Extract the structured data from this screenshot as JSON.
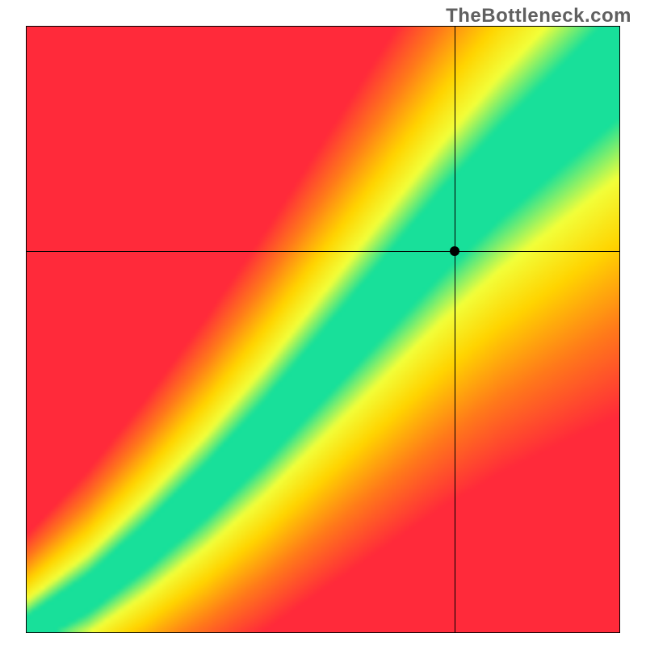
{
  "watermark": "TheBottleneck.com",
  "chart_data": {
    "type": "heatmap",
    "title": "",
    "xlabel": "",
    "ylabel": "",
    "xlim": [
      0,
      100
    ],
    "ylim": [
      0,
      100
    ],
    "crosshair": {
      "x": 72,
      "y": 63
    },
    "point": {
      "x": 72,
      "y": 63
    },
    "ridge": [
      {
        "x": 0,
        "y": 0
      },
      {
        "x": 10,
        "y": 6
      },
      {
        "x": 20,
        "y": 14
      },
      {
        "x": 30,
        "y": 23
      },
      {
        "x": 40,
        "y": 33
      },
      {
        "x": 50,
        "y": 44
      },
      {
        "x": 60,
        "y": 55
      },
      {
        "x": 70,
        "y": 66
      },
      {
        "x": 80,
        "y": 76
      },
      {
        "x": 90,
        "y": 85
      },
      {
        "x": 100,
        "y": 94
      }
    ],
    "color_stops": [
      {
        "t": 0.0,
        "color": "#ff2a3a"
      },
      {
        "t": 0.3,
        "color": "#ff7a1a"
      },
      {
        "t": 0.58,
        "color": "#ffd400"
      },
      {
        "t": 0.8,
        "color": "#f2ff3a"
      },
      {
        "t": 1.0,
        "color": "#18e09a"
      }
    ],
    "band_halfwidth_base": 2.5,
    "band_halfwidth_scale": 6.5,
    "grid_n": 130
  }
}
